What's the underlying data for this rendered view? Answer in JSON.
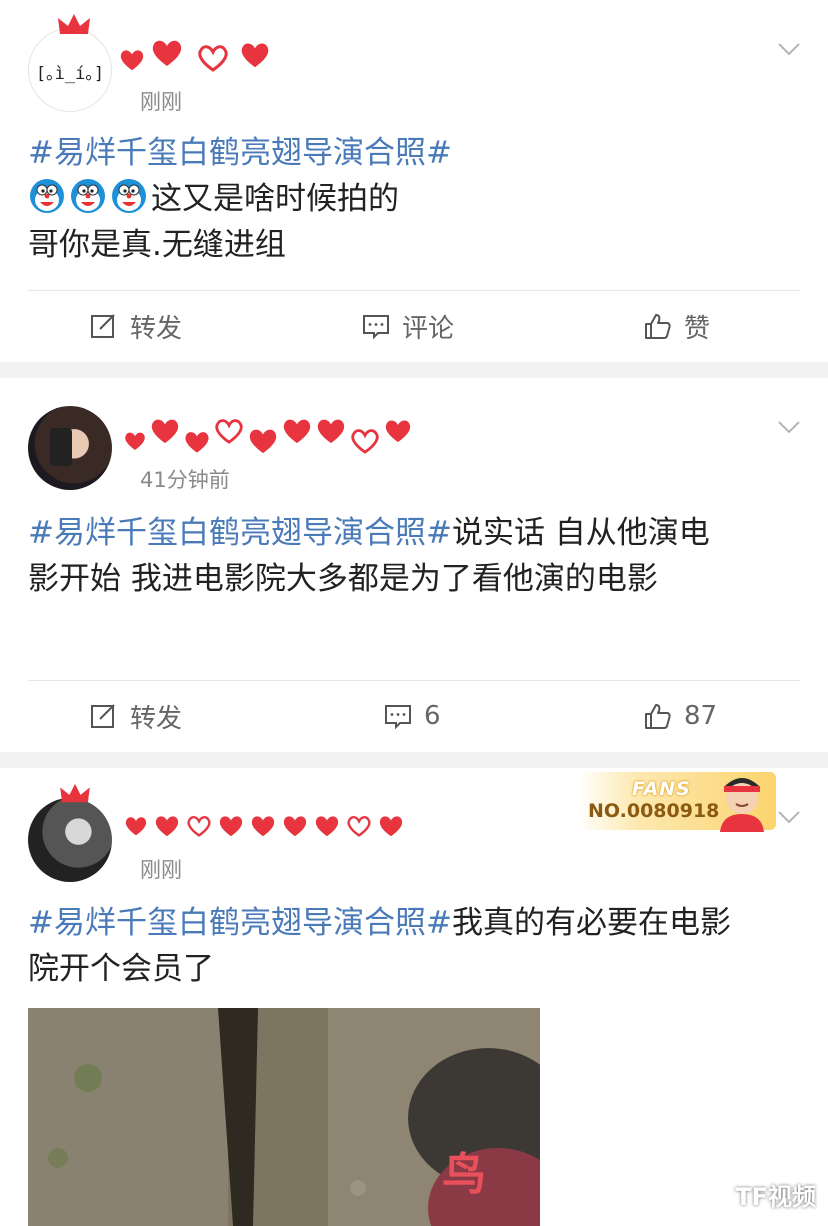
{
  "posts": [
    {
      "time": "刚刚",
      "topic": "#易烊千玺白鹤亮翅导演合照#",
      "line1": "这又是啥时候拍的",
      "line2": "哥你是真.无缝进组",
      "avatar_text": "[｡ì_í｡]",
      "repost_label": "转发",
      "comment_label": "评论",
      "like_label": "赞"
    },
    {
      "time": "41分钟前",
      "topic": "#易烊千玺白鹤亮翅导演合照#",
      "text_a": "说实话 自从他演电",
      "text_b": "影开始 我进电影院大多都是为了看他演的电影",
      "repost_label": "转发",
      "comment_count": "6",
      "like_count": "87"
    },
    {
      "time": "刚刚",
      "topic": "#易烊千玺白鹤亮翅导演合照#",
      "text_a": "我真的有必要在电影",
      "text_b": "院开个会员了",
      "badge_fans": "FANS",
      "badge_no": "NO.0080918",
      "photo_char": "鸟"
    }
  ],
  "watermark": "TF视频",
  "colors": {
    "topic": "#4a7ab8",
    "heart": "#e8343f",
    "secondary_text": "#8a8a8a",
    "separator": "#f2f2f2"
  }
}
